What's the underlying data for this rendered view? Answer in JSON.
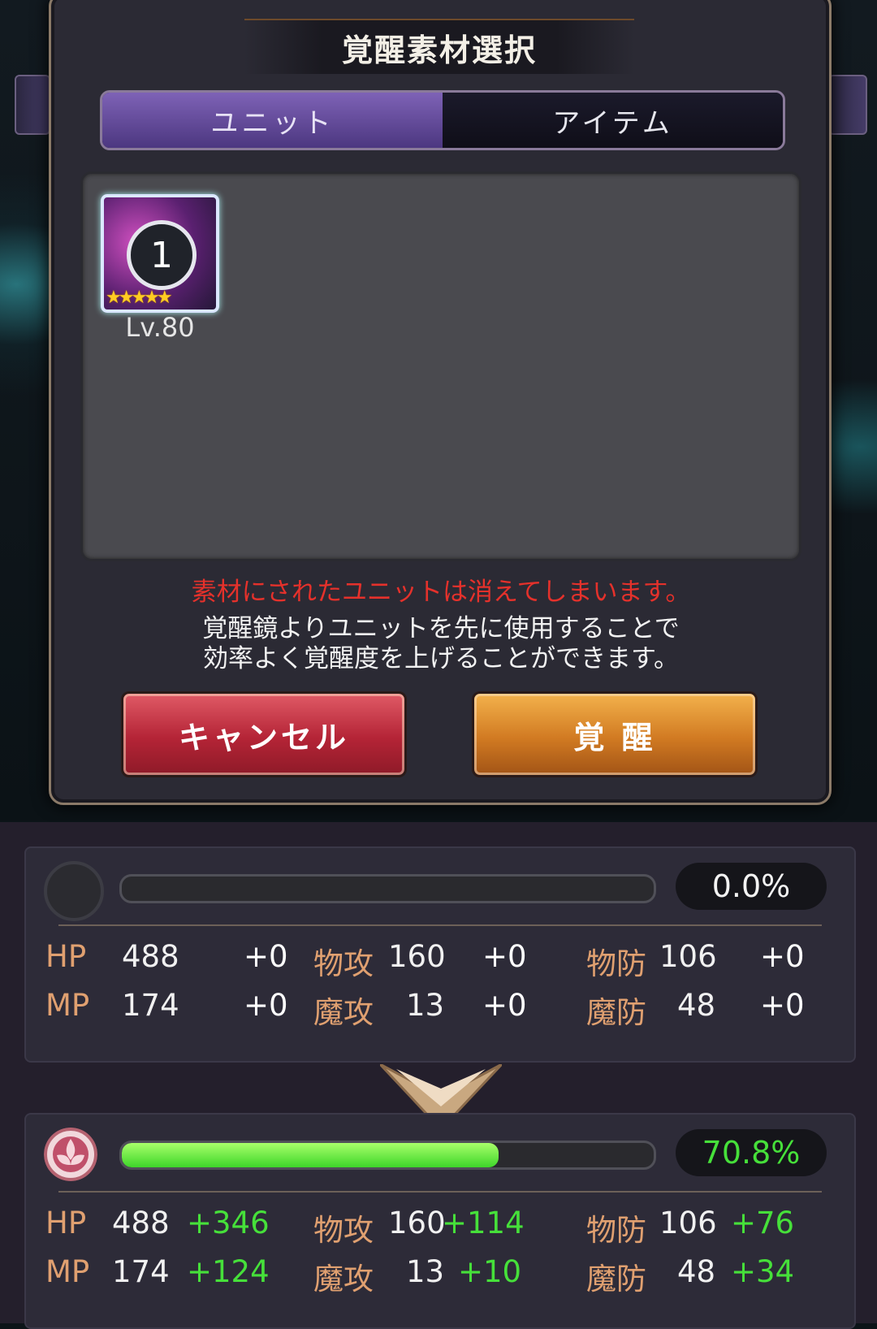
{
  "dialog": {
    "title": "覚醒素材選択",
    "tabs": [
      {
        "label": "ユニット"
      },
      {
        "label": "アイテム"
      }
    ],
    "unit": {
      "badge": "1",
      "stars": "★★★★★",
      "level": "Lv.80"
    },
    "warning": "素材にされたユニットは消えてしまいます。",
    "info_line1": "覚醒鏡よりユニットを先に使用することで",
    "info_line2": "効率よく覚醒度を上げることができます。",
    "cancel_label": "キャンセル",
    "awaken_label": "覚 醒"
  },
  "before": {
    "percent": "0.0%",
    "progress": 0.0,
    "rows": [
      {
        "l1": "HP",
        "v1": "488",
        "p1": "+0",
        "l2": "物攻",
        "v2": "160",
        "p2": "+0",
        "l3": "物防",
        "v3": "106",
        "p3": "+0"
      },
      {
        "l1": "MP",
        "v1": "174",
        "p1": "+0",
        "l2": "魔攻",
        "v2": "13",
        "p2": "+0",
        "l3": "魔防",
        "v3": "48",
        "p3": "+0"
      }
    ]
  },
  "after": {
    "percent": "70.8%",
    "progress": 0.708,
    "rows": [
      {
        "l1": "HP",
        "v1": "488",
        "p1": "+346",
        "l2": "物攻",
        "v2": "160",
        "p2": "+114",
        "l3": "物防",
        "v3": "106",
        "p3": "+76"
      },
      {
        "l1": "MP",
        "v1": "174",
        "p1": "+124",
        "l2": "魔攻",
        "v2": "13",
        "p2": "+10",
        "l3": "魔防",
        "v3": "48",
        "p3": "+34"
      }
    ]
  },
  "colors": {
    "accent_green": "#46e03a",
    "warning_red": "#e5312b",
    "stat_label": "#e0a070"
  },
  "icons": {
    "before": "empty-circle-icon",
    "after": "sakura-emblem-icon",
    "divider": "chevron-down-icon"
  }
}
